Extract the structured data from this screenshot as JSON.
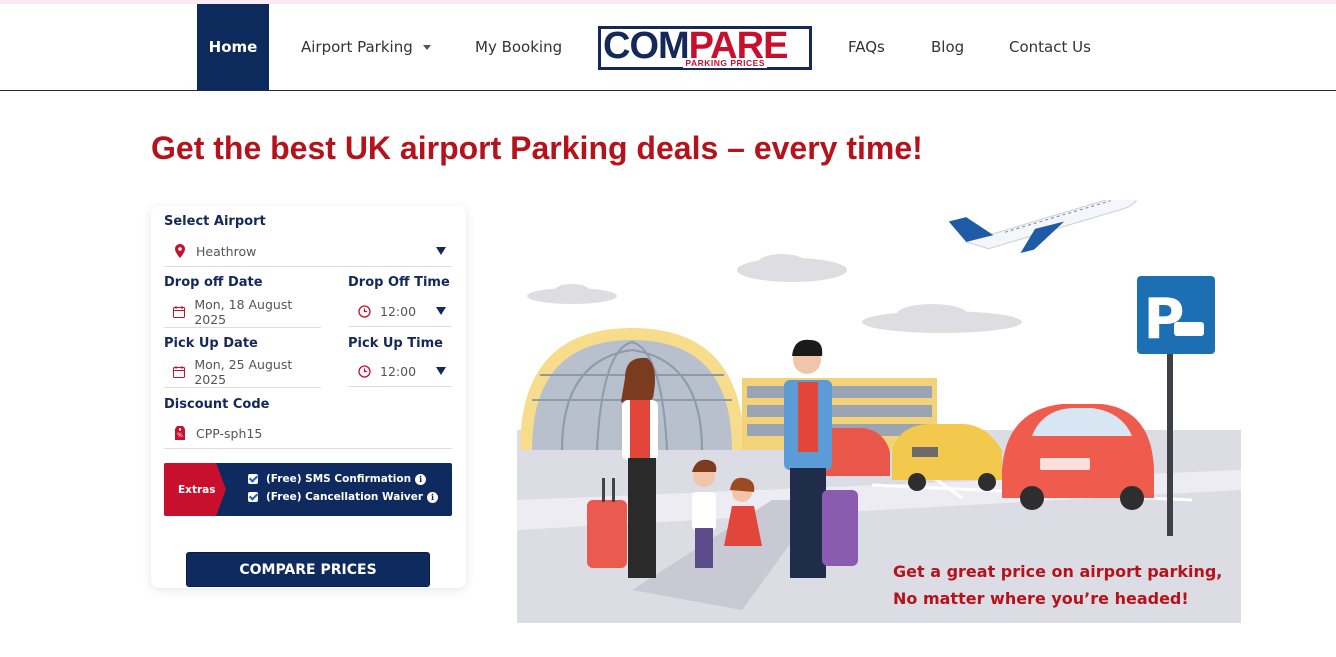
{
  "nav": {
    "items": [
      {
        "label": "Home",
        "active": true
      },
      {
        "label": "Airport Parking",
        "dropdown": true
      },
      {
        "label": "My Booking"
      },
      {
        "label": "FAQs"
      },
      {
        "label": "Blog"
      },
      {
        "label": "Contact Us"
      }
    ],
    "logo": {
      "main_left": "COM",
      "main_right": "PARE",
      "sub": "PARKING PRICES"
    }
  },
  "headline": "Get the best UK airport Parking deals – every time!",
  "form": {
    "select_airport_label": "Select Airport",
    "airport_value": "Heathrow",
    "dropoff_date_label": "Drop off Date",
    "dropoff_date_value": "Mon, 18 August 2025",
    "dropoff_time_label": "Drop Off Time",
    "dropoff_time_value": "12:00",
    "pickup_date_label": "Pick Up Date",
    "pickup_date_value": "Mon, 25 August 2025",
    "pickup_time_label": "Pick Up Time",
    "pickup_time_value": "12:00",
    "discount_label": "Discount Code",
    "discount_value": "CPP-sph15",
    "extras_label": "Extras",
    "extras": [
      {
        "label": "(Free) SMS Confirmation",
        "checked": true
      },
      {
        "label": "(Free) Cancellation Waiver",
        "checked": true
      }
    ],
    "submit_label": "COMPARE PRICES"
  },
  "hero": {
    "caption_line1": "Get a great price on airport parking,",
    "caption_line2": "No matter where you’re headed!",
    "parking_sign": "P"
  },
  "colors": {
    "navy": "#0f2a5e",
    "red": "#b5121b",
    "accent_red": "#c8102e"
  }
}
